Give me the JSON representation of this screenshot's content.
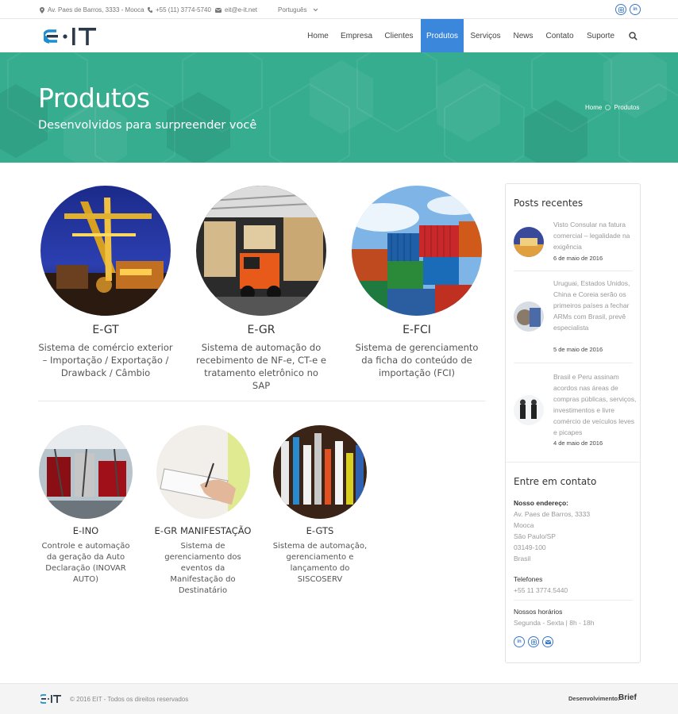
{
  "topbar": {
    "address": "Av. Paes de Barros, 3333 - Mooca",
    "phone": "+55 (11) 3774-5740",
    "email": "eit@e-it.net",
    "language": "Português"
  },
  "header": {
    "logo_text": "E·IT",
    "nav": [
      "Home",
      "Empresa",
      "Clientes",
      "Produtos",
      "Serviços",
      "News",
      "Contato",
      "Suporte"
    ],
    "active_nav": "Produtos"
  },
  "hero": {
    "title": "Produtos",
    "subtitle": "Desenvolvidos para surpreender você",
    "breadcrumb": [
      "Home",
      "Produtos"
    ]
  },
  "products_row1": [
    {
      "name": "E-GT",
      "desc": "Sistema de comércio exterior – Importação / Exportação / Drawback / Câmbio"
    },
    {
      "name": "E-GR",
      "desc": "Sistema de automação do recebimento de NF-e, CT-e e tratamento eletrônico no SAP"
    },
    {
      "name": "E-FCI",
      "desc": "Sistema de gerenciamento da ficha do conteúdo de importação (FCI)"
    }
  ],
  "products_row2": [
    {
      "name": "E-INO",
      "desc": "Controle e automação da geração da Auto Declaração (INOVAR AUTO)"
    },
    {
      "name": "E-GR MANIFESTAÇÃO",
      "desc": "Sistema de gerenciamento dos eventos da Manifestação do Destinatário"
    },
    {
      "name": "E-GTS",
      "desc": "Sistema de automação, gerenciamento e lançamento do SISCOSERV"
    }
  ],
  "sidebar": {
    "recent_title": "Posts recentes",
    "posts": [
      {
        "title": "Visto Consular na fatura comercial – legalidade na exigência",
        "date": "6 de maio de 2016"
      },
      {
        "title": "Uruguai, Estados Unidos, China e Coreia serão os primeiros países a fechar ARMs com Brasil, prevê especialista",
        "date": "5 de maio de 2016"
      },
      {
        "title": "Brasil e Peru assinam acordos nas áreas de compras públicas, serviços, investimentos e livre comércio de veículos leves e picapes",
        "date": "4 de maio de 2016"
      }
    ],
    "contact_title": "Entre em contato",
    "address_label": "Nosso endereço:",
    "address_lines": [
      "Av. Paes de Barros, 3333",
      "Mooca",
      "São Paulo/SP",
      "03149-100",
      "Brasil"
    ],
    "phones_label": "Telefones",
    "phone": "+55 11 3774.5440",
    "hours_label": "Nossos horários",
    "hours": "Segunda - Sexta | 8h - 18h"
  },
  "footer": {
    "copyright": "© 2016 EIT - Todos os direitos reservados",
    "dev_label": "Desenvolvimento:",
    "dev_brand": "Brief"
  },
  "colors": {
    "accent": "#3a87dc",
    "hero": "#36ad8f",
    "social": "#3b79c9"
  }
}
